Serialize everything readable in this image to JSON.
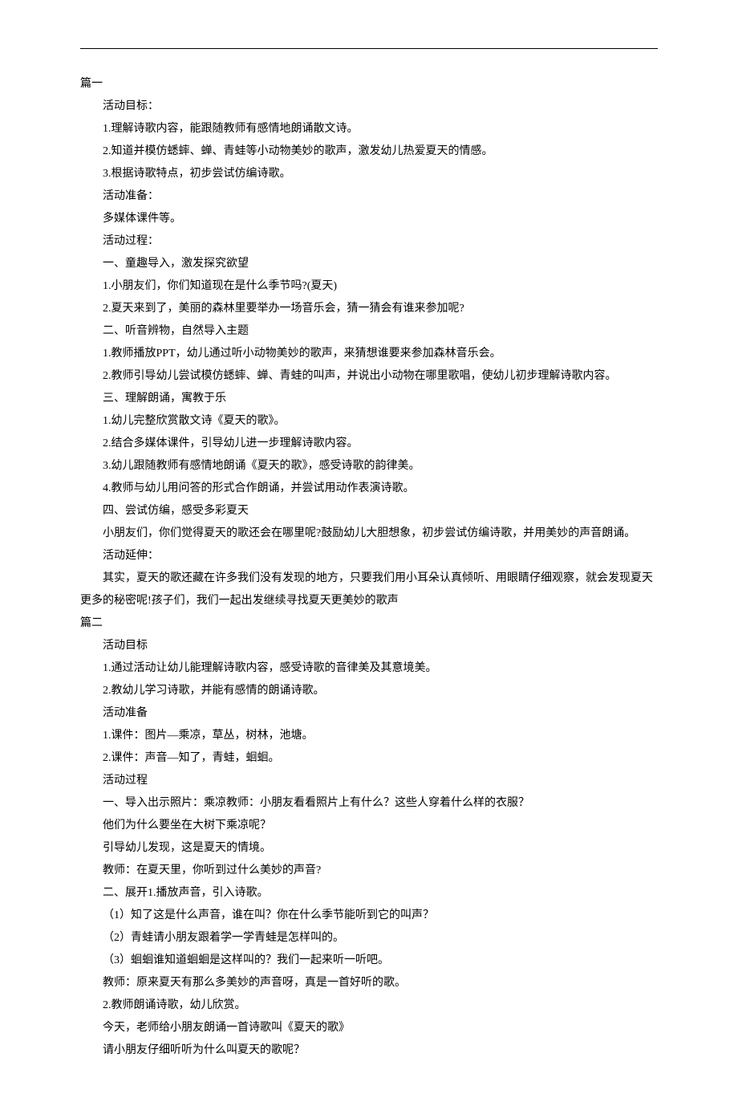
{
  "sections": [
    {
      "title": "篇一",
      "paragraphs": [
        "活动目标：",
        "1.理解诗歌内容，能跟随教师有感情地朗诵散文诗。",
        "2.知道并模仿蟋蟀、蝉、青蛙等小动物美妙的歌声，激发幼儿热爱夏天的情感。",
        "3.根据诗歌特点，初步尝试仿编诗歌。",
        "活动准备：",
        "多媒体课件等。",
        "活动过程：",
        "一、童趣导入，激发探究欲望",
        "1.小朋友们，你们知道现在是什么季节吗?(夏天)",
        "2.夏天来到了，美丽的森林里要举办一场音乐会，猜一猜会有谁来参加呢?",
        "二、听音辨物，自然导入主题",
        "1.教师播放PPT，幼儿通过听小动物美妙的歌声，来猜想谁要来参加森林音乐会。",
        "2.教师引导幼儿尝试模仿蟋蟀、蝉、青蛙的叫声，并说出小动物在哪里歌唱，使幼儿初步理解诗歌内容。",
        "三、理解朗诵，寓教于乐",
        "1.幼儿完整欣赏散文诗《夏天的歌》。",
        "2.结合多媒体课件，引导幼儿进一步理解诗歌内容。",
        "3.幼儿跟随教师有感情地朗诵《夏天的歌》，感受诗歌的韵律美。",
        "4.教师与幼儿用问答的形式合作朗诵，并尝试用动作表演诗歌。",
        "四、尝试仿编，感受多彩夏天",
        "小朋友们，你们觉得夏天的歌还会在哪里呢?鼓励幼儿大胆想象，初步尝试仿编诗歌，并用美妙的声音朗诵。",
        "活动延伸："
      ],
      "paragraphs_flush": [
        "　　其实，夏天的歌还藏在许多我们没有发现的地方，只要我们用小耳朵认真倾听、用眼睛仔细观察，就会发现夏天更多的秘密呢!孩子们，我们一起出发继续寻找夏天更美妙的歌声"
      ]
    },
    {
      "title": "篇二",
      "paragraphs": [
        "活动目标",
        "1.通过活动让幼儿能理解诗歌内容，感受诗歌的音律美及其意境美。",
        "2.教幼儿学习诗歌，并能有感情的朗诵诗歌。",
        "活动准备",
        "1.课件：图片—乘凉，草丛，树林，池塘。",
        "2.课件：声音—知了，青蛙，蛔蛔。",
        "活动过程",
        "一、导入出示照片：乘凉教师：小朋友看看照片上有什么？这些人穿着什么样的衣服？",
        "他们为什么要坐在大树下乘凉呢？",
        "引导幼儿发现，这是夏天的情境。",
        "教师：在夏天里，你听到过什么美妙的声音?",
        "二、展开1.播放声音，引入诗歌。",
        "（1）知了这是什么声音，谁在叫？你在什么季节能听到它的叫声？",
        "（2）青蛙请小朋友跟着学一学青蛙是怎样叫的。",
        "（3）蛔蛔谁知道蛔蛔是这样叫的？我们一起来听一听吧。",
        "教师：原来夏天有那么多美妙的声音呀，真是一首好听的歌。",
        "2.教师朗诵诗歌，幼儿欣赏。",
        "今天，老师给小朋友朗诵一首诗歌叫《夏天的歌》",
        "请小朋友仔细听听为什么叫夏天的歌呢？"
      ],
      "paragraphs_flush": []
    }
  ]
}
